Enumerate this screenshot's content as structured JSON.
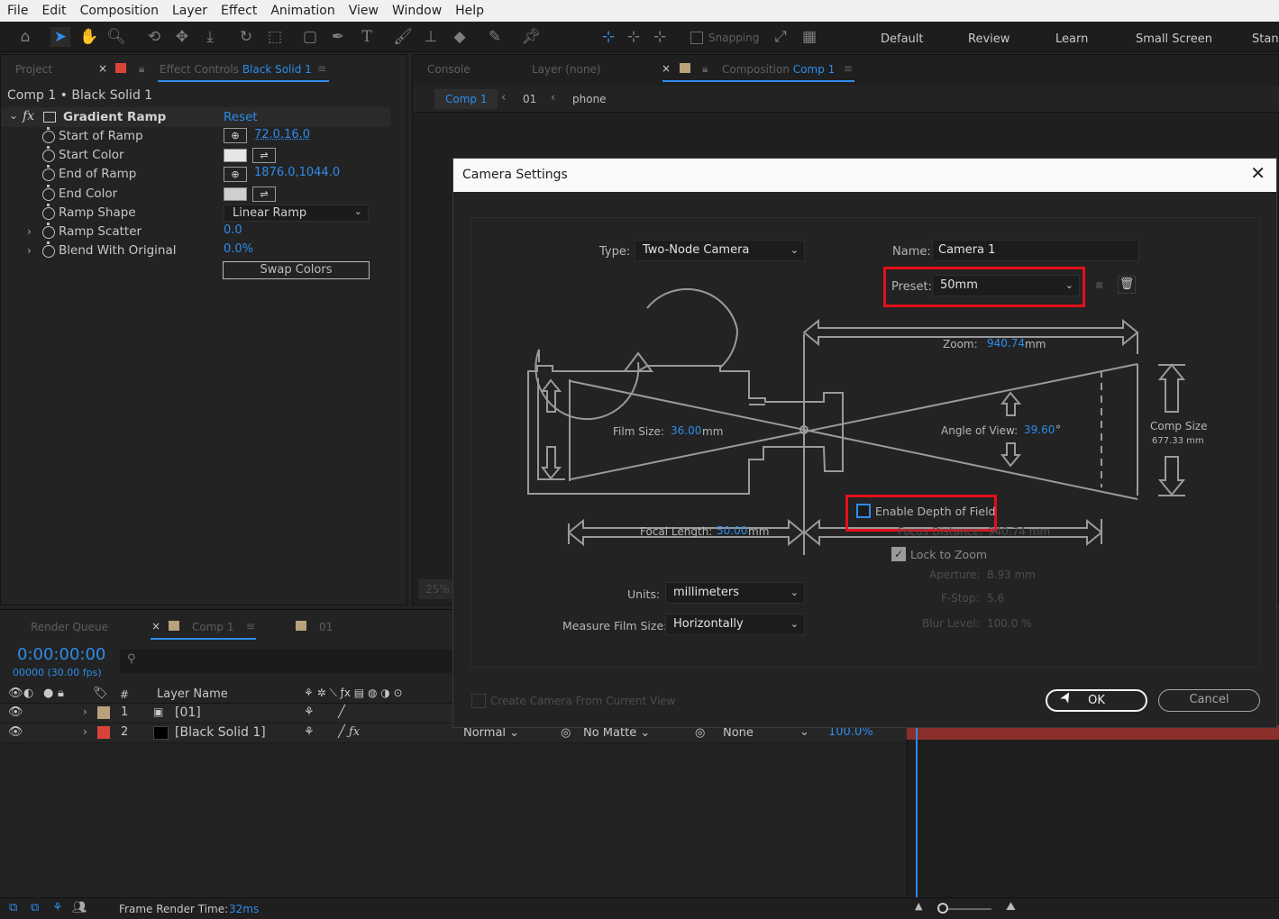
{
  "menu": [
    "File",
    "Edit",
    "Composition",
    "Layer",
    "Effect",
    "Animation",
    "View",
    "Window",
    "Help"
  ],
  "toolbar": {
    "snapping_label": "Snapping",
    "workspaces": [
      "Default",
      "Review",
      "Learn",
      "Small Screen",
      "Stanc"
    ]
  },
  "left_panel": {
    "tab_project": "Project",
    "tab_effect_controls": "Effect Controls",
    "tab_effect_target": "Black Solid 1",
    "breadcrumb": "Comp 1 • Black Solid 1",
    "effect_name": "Gradient Ramp",
    "reset_label": "Reset",
    "properties": [
      {
        "label": "Start of Ramp",
        "value": "72.0,16.0"
      },
      {
        "label": "Start Color",
        "value": ""
      },
      {
        "label": "End of Ramp",
        "value": "1876.0,1044.0"
      },
      {
        "label": "End Color",
        "value": ""
      },
      {
        "label": "Ramp Shape",
        "value": "Linear Ramp"
      },
      {
        "label": "Ramp Scatter",
        "value": "0.0"
      },
      {
        "label": "Blend With Original",
        "value": "0.0%"
      }
    ],
    "swap_colors_label": "Swap Colors",
    "start_color": "#e6e6e6",
    "end_color": "#cfcfcf"
  },
  "comp_panel": {
    "tab_console": "Console",
    "tab_layer": "Layer (none)",
    "tab_composition": "Composition",
    "tab_comp_name": "Comp 1",
    "crumbs": [
      "Comp 1",
      "01",
      "phone"
    ],
    "zoom": "25%"
  },
  "dialog": {
    "title": "Camera Settings",
    "type_label": "Type:",
    "type_value": "Two-Node Camera",
    "name_label": "Name:",
    "name_value": "Camera 1",
    "preset_label": "Preset:",
    "preset_value": "50mm",
    "zoom_label": "Zoom:",
    "zoom_value": "940.74",
    "zoom_unit": "mm",
    "film_size_label": "Film Size:",
    "film_size_value": "36.00",
    "film_size_unit": "mm",
    "angle_label": "Angle of View:",
    "angle_value": "39.60",
    "angle_unit": "°",
    "comp_size_label": "Comp Size",
    "comp_size_value": "677.33 mm",
    "dof_label": "Enable Depth of Field",
    "dof_checked": false,
    "focal_label": "Focal Length:",
    "focal_value": "50.00",
    "focal_unit": "mm",
    "focus_distance_label": "Focus Distance:",
    "focus_distance_value": "940.74 mm",
    "lock_zoom_label": "Lock to Zoom",
    "lock_zoom_checked": true,
    "aperture_label": "Aperture:",
    "aperture_value": "8.93 mm",
    "fstop_label": "F-Stop:",
    "fstop_value": "5.6",
    "blur_label": "Blur Level:",
    "blur_value": "100.0 %",
    "units_label": "Units:",
    "units_value": "millimeters",
    "measure_label": "Measure Film Size:",
    "measure_value": "Horizontally",
    "create_from_view_label": "Create Camera From Current View",
    "ok_label": "OK",
    "cancel_label": "Cancel"
  },
  "timeline": {
    "tab_render_queue": "Render Queue",
    "tab_comp1": "Comp 1",
    "tab_01": "01",
    "timecode": "0:00:00:00",
    "frames": "00000 (30.00 fps)",
    "col_num": "#",
    "col_layer_name": "Layer Name",
    "layers": [
      {
        "num": "1",
        "name": "[01]",
        "label_color": "#b9a27c"
      },
      {
        "num": "2",
        "name": "[Black Solid 1]",
        "label_color": "#d9443a"
      }
    ],
    "mode": "Normal",
    "matte": "No Matte",
    "parent": "None",
    "opacity": "100.0%"
  },
  "status": {
    "frame_render_label": "Frame Render Time:",
    "frame_render_value": "32ms"
  }
}
